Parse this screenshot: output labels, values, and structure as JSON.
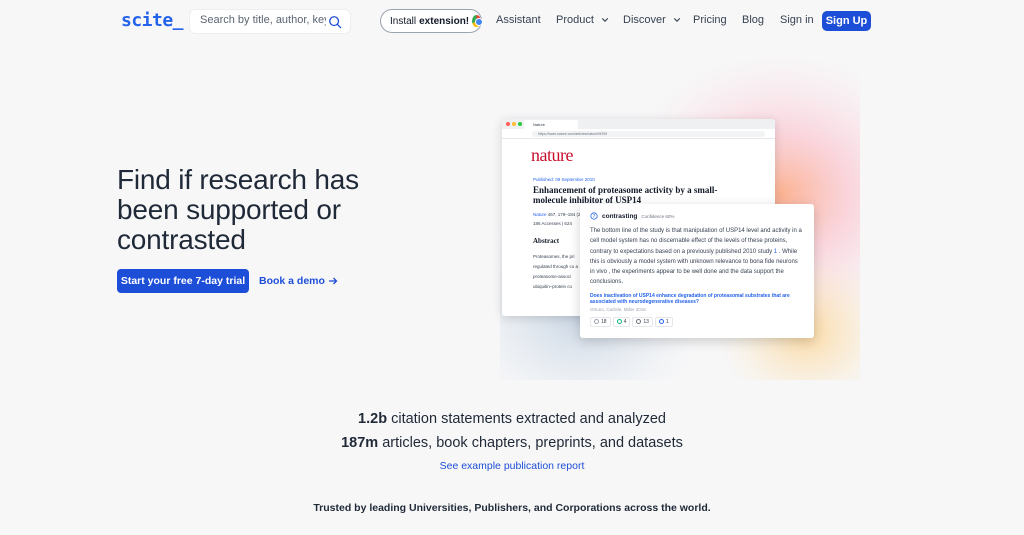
{
  "nav": {
    "logo": "scite_",
    "search_placeholder": "Search by title, author, key...",
    "install_prefix": "Install",
    "install_bold": "extension!",
    "links": [
      {
        "label": "Assistant"
      },
      {
        "label": "Product"
      },
      {
        "label": "Discover"
      },
      {
        "label": "Pricing"
      },
      {
        "label": "Blog"
      },
      {
        "label": "Sign in"
      }
    ],
    "signup": "Sign Up"
  },
  "hero": {
    "headline": "Find if research has been supported or contrasted",
    "trial_button": "Start your free 7-day trial",
    "demo_link": "Book a demo"
  },
  "illustration": {
    "browser_tab": "Nature",
    "url": "https://www.nature.com/articles/nature09299",
    "journal_logo": "nature",
    "published": "Published: 09 September 2010",
    "article_title": "Enhancement of proteasome activity by a small-molecule inhibitor of USP14",
    "meta_journal": "Nature",
    "meta_volume": "467, 179–184 (2010)",
    "stats_accesses": "186 Accesses | 624",
    "abstract_heading": "Abstract",
    "abstract_text": "Proteasomes, the pri regulated through co a proteasome-associ ubiquitin–protein co",
    "card": {
      "label": "contrasting",
      "confidence": "Confidence 60%",
      "text_before_ref": "The bottom line of the study is that manipulation of USP14 level and activity in a cell model system has no discernable effect of the levels of these proteins, contrary to expectations based on a previously published 2010 study",
      "ref": "1",
      "text_after_ref": ". While this is obviously a model system with unknown relevance to bona fide neurons in vivo , the experiments appear to be well done and the data support the conclusions.",
      "link": "Does inactivation of USP14 enhance degradation of proteasomal substrates that are associated with neurodegenerative diseases?",
      "authors": "Ortuno, Carlisle, Miller 2016",
      "chips": [
        "18",
        "4",
        "13",
        "1"
      ]
    }
  },
  "stats": {
    "line1_number": "1.2b",
    "line1_text": "citation statements extracted and analyzed",
    "line2_number": "187m",
    "line2_text": "articles, book chapters, preprints, and datasets",
    "report_link": "See example publication report"
  },
  "trusted": "Trusted by leading Universities, Publishers, and Corporations across the world.",
  "colors": {
    "brand": "#1d4ed8",
    "nature_red": "#c8102e",
    "background": "#f7f7f8"
  }
}
